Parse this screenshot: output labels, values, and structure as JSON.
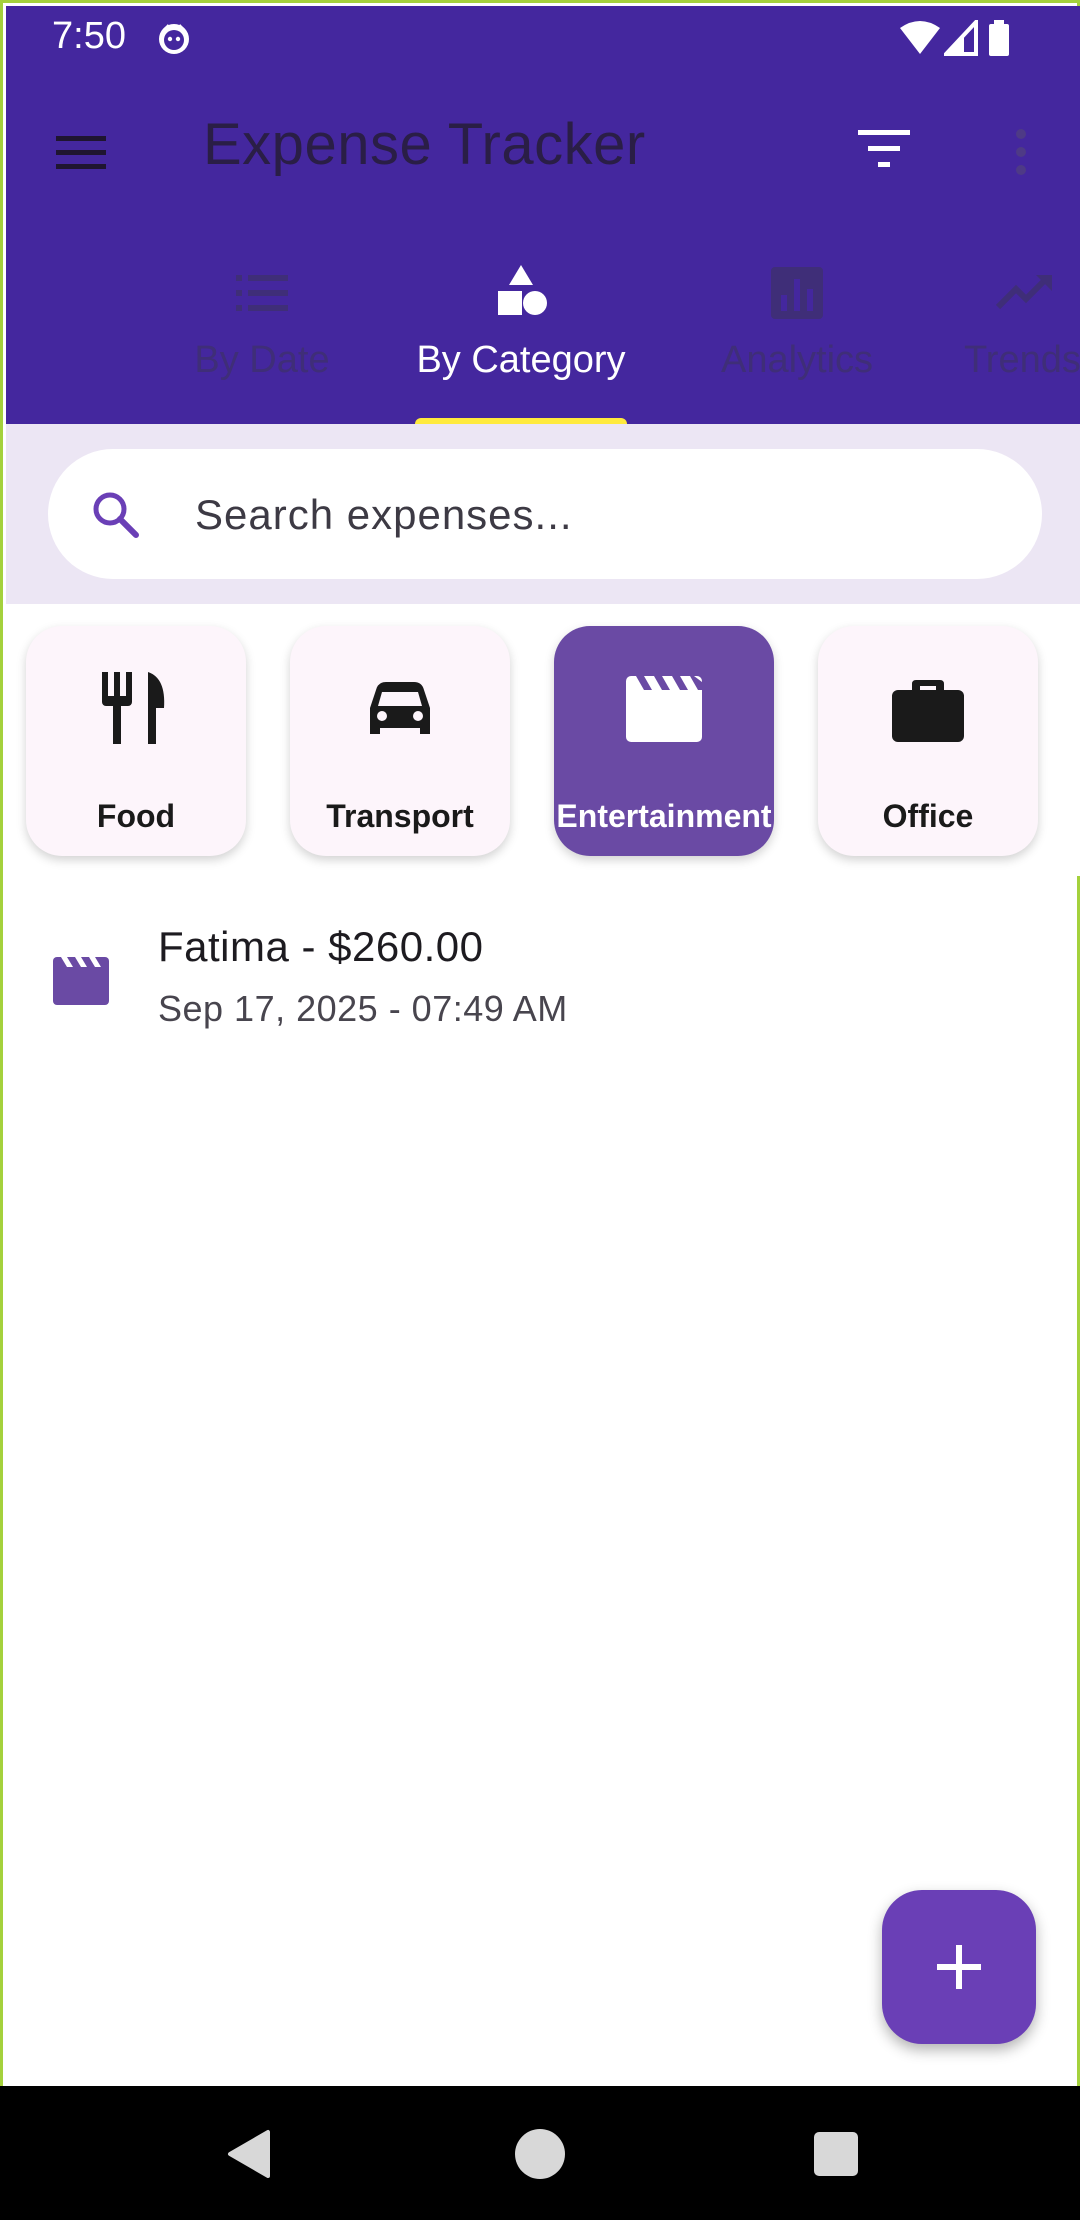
{
  "status_bar": {
    "time": "7:50"
  },
  "app": {
    "title": "Expense Tracker"
  },
  "tabs": [
    {
      "label": "By Date",
      "icon": "list-icon",
      "active": false
    },
    {
      "label": "By Category",
      "icon": "category-icon",
      "active": true
    },
    {
      "label": "Analytics",
      "icon": "analytics-icon",
      "active": false
    },
    {
      "label": "Trends",
      "icon": "trending-up-icon",
      "active": false
    }
  ],
  "search": {
    "placeholder": "Search expenses..."
  },
  "categories": [
    {
      "label": "Food",
      "icon": "restaurant-icon",
      "selected": false
    },
    {
      "label": "Transport",
      "icon": "car-icon",
      "selected": false
    },
    {
      "label": "Entertainment",
      "icon": "movie-icon",
      "selected": true
    },
    {
      "label": "Office",
      "icon": "briefcase-icon",
      "selected": false
    }
  ],
  "expenses": [
    {
      "title": "Fatima - $260.00",
      "subtitle": "Sep 17, 2025 - 07:49 AM",
      "icon": "movie-icon"
    }
  ],
  "fab": {
    "icon": "add-icon"
  },
  "colors": {
    "app_bar": "#44279e",
    "tab_indicator": "#ffea3d",
    "chip_selected": "#6a4aa4",
    "fab": "#6a3fb6",
    "search_zone": "#ece6f4"
  }
}
